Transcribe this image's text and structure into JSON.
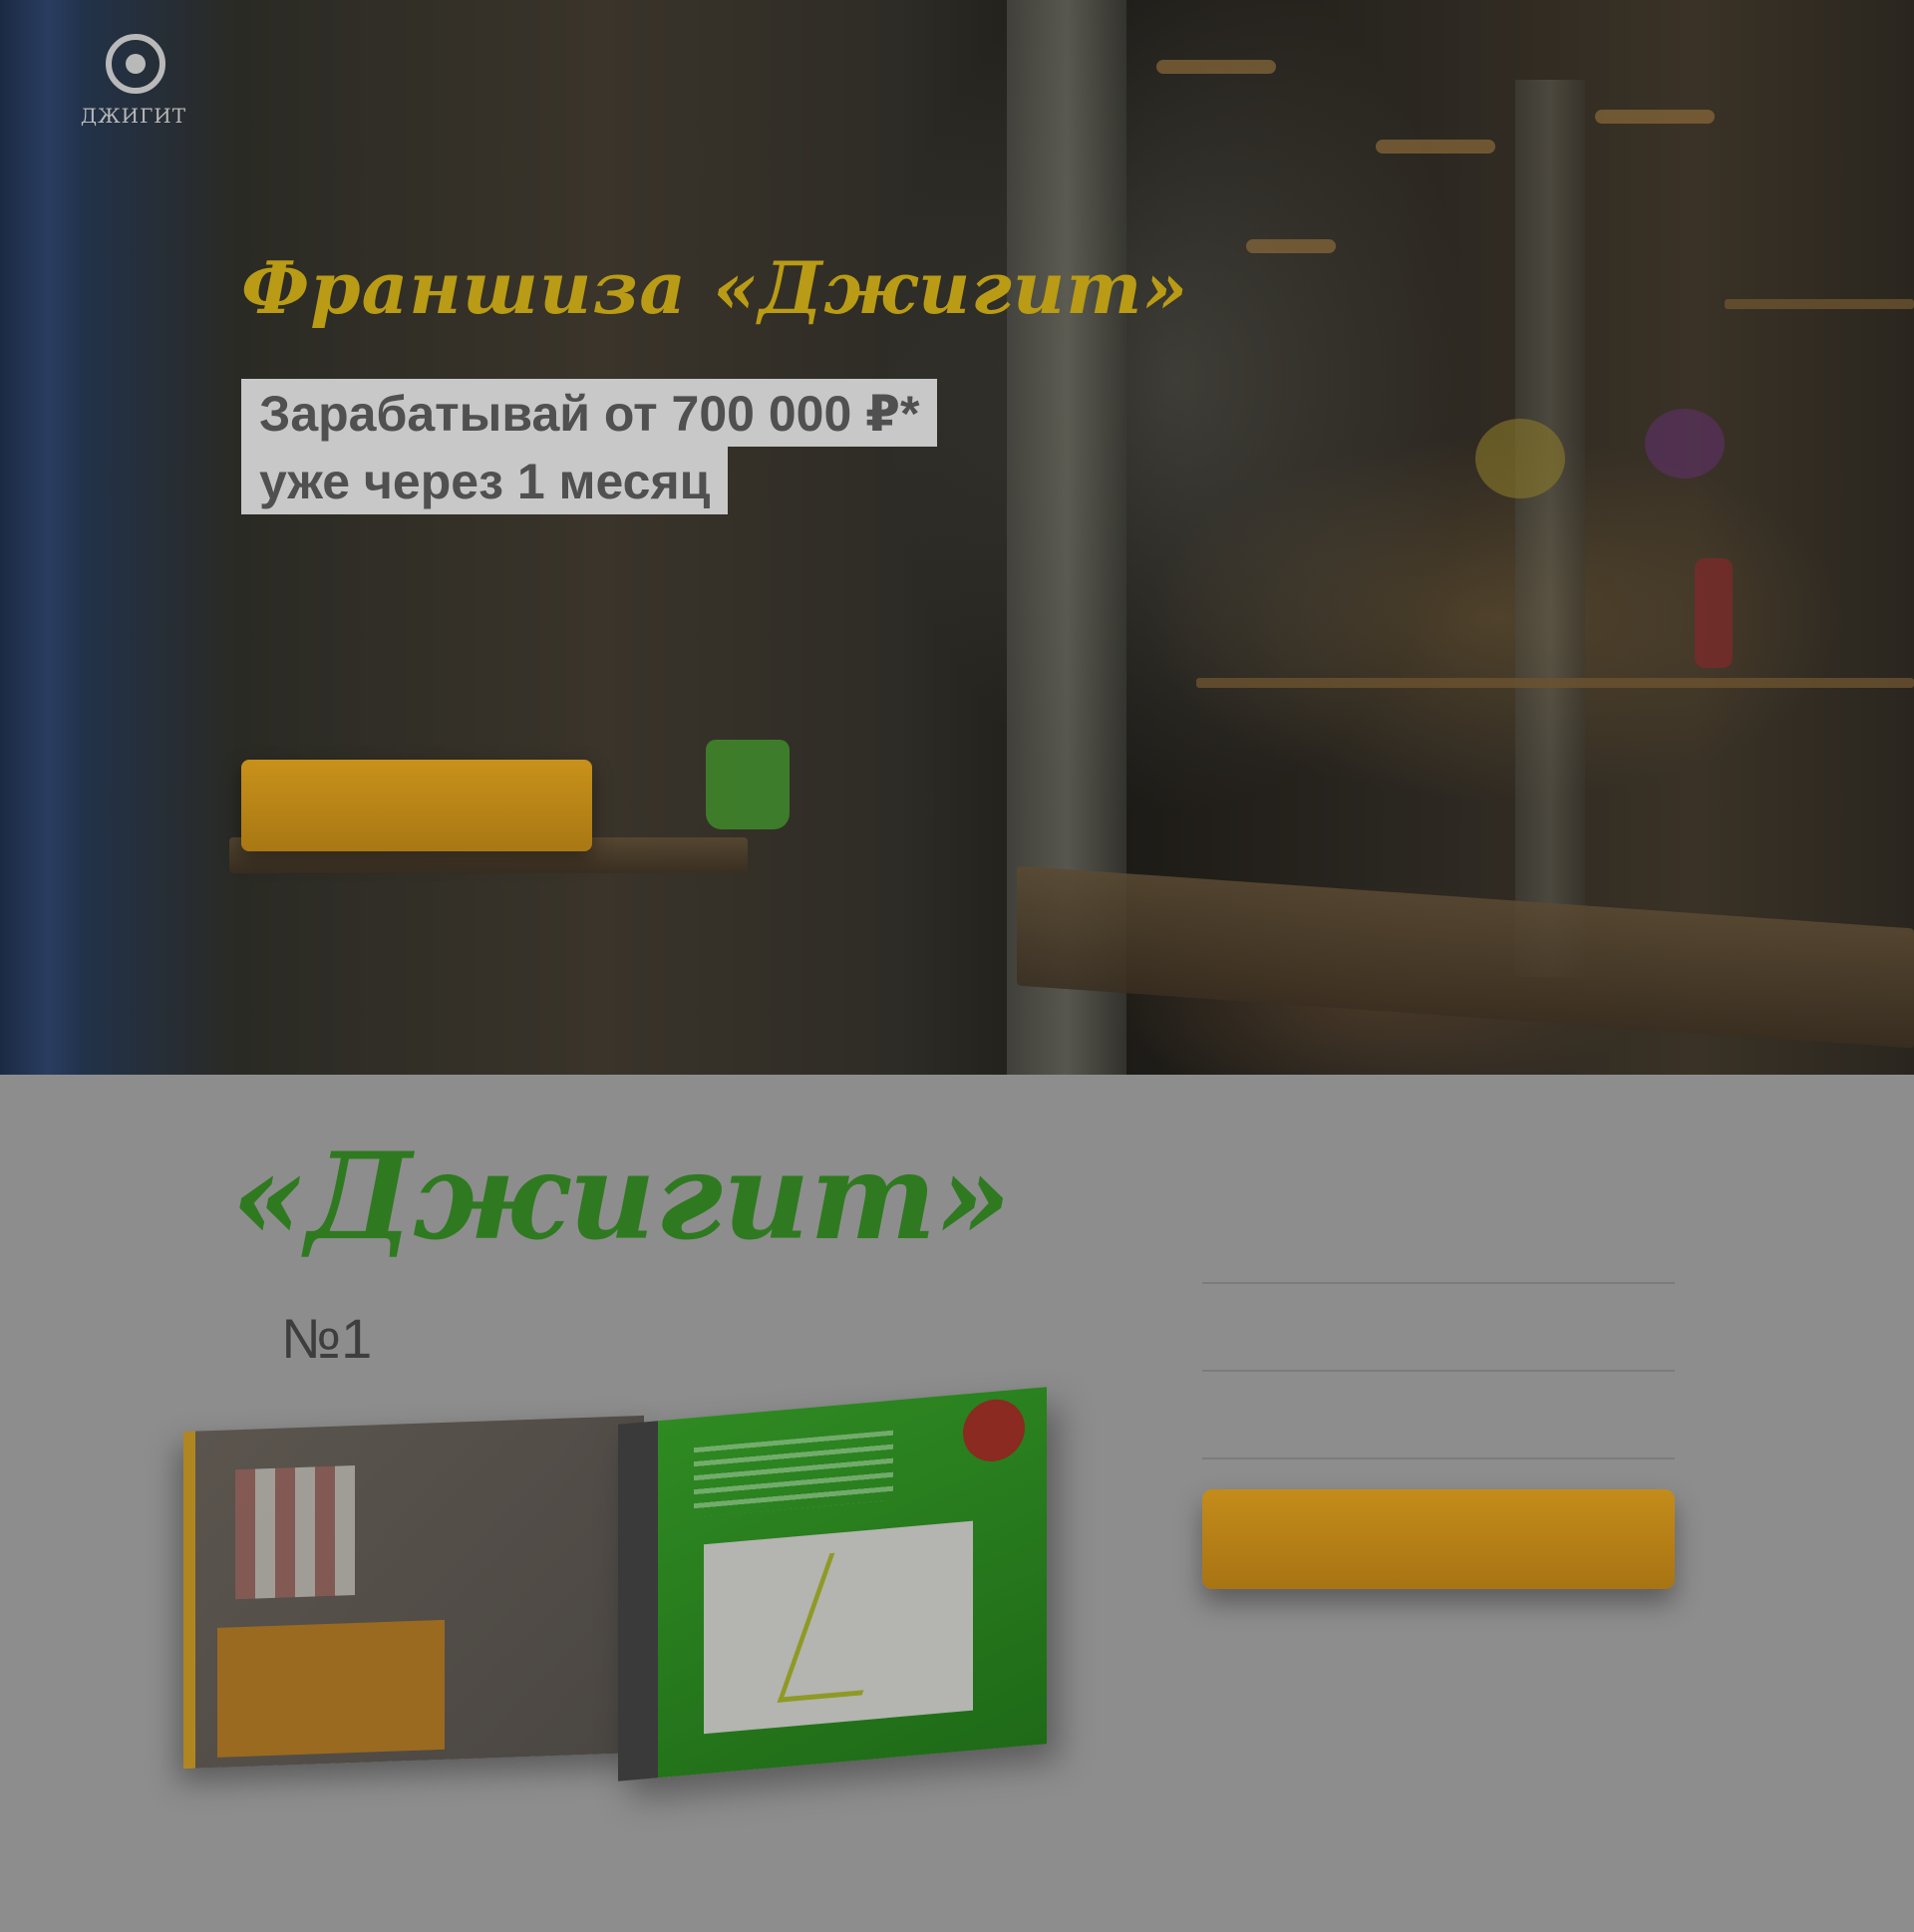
{
  "header": {
    "logo_text": "ДЖИГИТ",
    "tagline_lines": [
      "",
      ""
    ],
    "nav": [
      "",
      ""
    ]
  },
  "hero": {
    "title": "Франшиза «Джигит»",
    "subtitle_line1": "Зарабатывай от 700 000 ₽*",
    "subtitle_line2": "уже через 1 месяц",
    "desc_paragraph1": "",
    "desc_paragraph2": "",
    "cta_label": ""
  },
  "brand": {
    "wordmark": "«Джигит»",
    "rank_number": "№1",
    "rank_desc": ""
  },
  "form": {
    "title": "",
    "fields": [
      {
        "placeholder": ""
      },
      {
        "placeholder": ""
      },
      {
        "placeholder": ""
      }
    ],
    "submit_label": ""
  },
  "colors": {
    "accent_gold": "#c8911a",
    "brand_green": "#2f7a20",
    "overlay_gray": "#8d8d8d"
  }
}
